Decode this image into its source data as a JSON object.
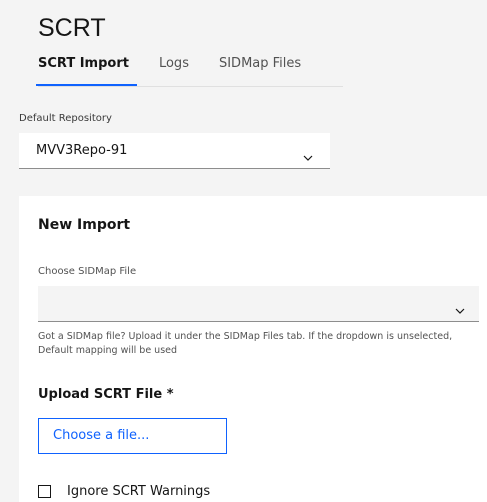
{
  "app": {
    "title": "SCRT"
  },
  "tabs": [
    {
      "label": "SCRT Import",
      "active": true
    },
    {
      "label": "Logs",
      "active": false
    },
    {
      "label": "SIDMap Files",
      "active": false
    }
  ],
  "repository": {
    "label": "Default Repository",
    "value": "MVV3Repo-91",
    "chevron_icon": "chevron-down"
  },
  "new_import": {
    "title": "New Import",
    "sidmap": {
      "label": "Choose SIDMap File",
      "value": "",
      "chevron_icon": "chevron-down",
      "helper": "Got a SIDMap file? Upload it under the SIDMap Files tab. If the dropdown is unselected, Default mapping will be used"
    },
    "upload": {
      "title": "Upload SCRT File *",
      "button_label": "Choose a file..."
    },
    "ignore_warnings": {
      "label": "Ignore SCRT Warnings",
      "checked": false
    }
  },
  "colors": {
    "accent": "#0f62fe",
    "page_bg": "#f4f4f4",
    "card_bg": "#ffffff",
    "text": "#161616"
  }
}
